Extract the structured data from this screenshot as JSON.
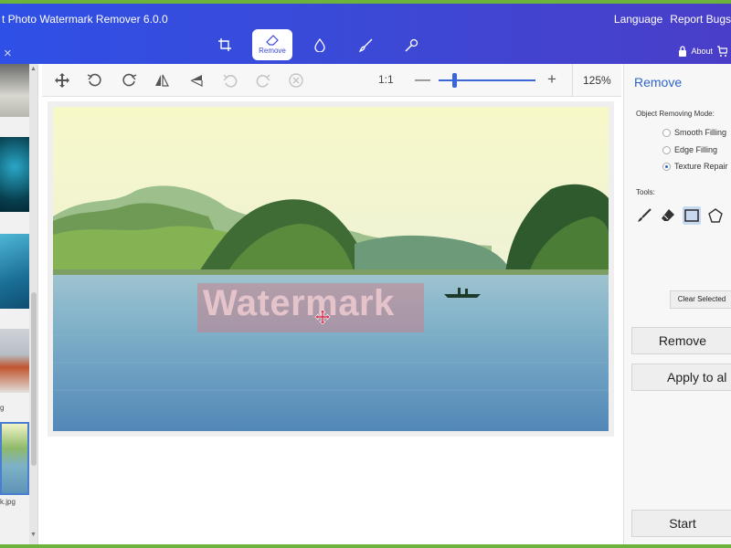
{
  "app": {
    "title": "t Photo Watermark Remover 6.0.0"
  },
  "top_links": {
    "language": "Language",
    "report_bugs": "Report Bugs"
  },
  "close_label": "×",
  "modes": [
    {
      "name": "crop-icon",
      "label": ""
    },
    {
      "name": "eraser-icon",
      "label": "Remove"
    },
    {
      "name": "drop-icon",
      "label": ""
    },
    {
      "name": "brush-icon",
      "label": ""
    },
    {
      "name": "pin-icon",
      "label": ""
    }
  ],
  "about_label": "About",
  "thumbnails": [
    {
      "caption": ""
    },
    {
      "caption": ""
    },
    {
      "caption": ""
    },
    {
      "caption": "g"
    },
    {
      "caption": "k.jpg"
    }
  ],
  "toolbar": {
    "ratio": "1:1",
    "minus": "—",
    "plus": "+",
    "zoom_label": "125%",
    "zoom_level": 0.15
  },
  "image": {
    "watermark_text": "Watermark"
  },
  "panel": {
    "title": "Remove",
    "mode_label": "Object Removing Mode:",
    "modes": [
      {
        "label": "Smooth Filling",
        "selected": false
      },
      {
        "label": "Edge Filling",
        "selected": false
      },
      {
        "label": "Texture Repair",
        "selected": true
      }
    ],
    "tools_label": "Tools:",
    "clear_selected": "Clear Selected",
    "remove": "Remove",
    "apply_to_all": "Apply to al",
    "start": "Start"
  },
  "colors": {
    "accent": "#2f64c8",
    "titlebar": "#3a4ad8",
    "frame_green": "#6bb33a"
  }
}
